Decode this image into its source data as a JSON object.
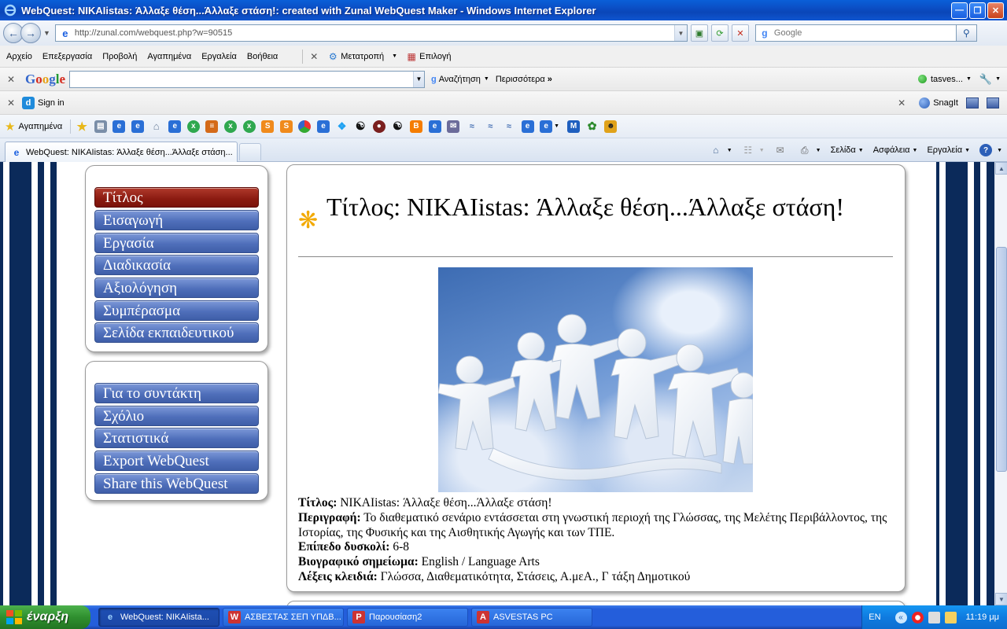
{
  "window": {
    "title": "WebQuest: NIKAIistas: Άλλαξε θέση...Άλλαξε στάση!: created with Zunal WebQuest Maker - Windows Internet Explorer"
  },
  "address_bar": {
    "url": "http://zunal.com/webquest.php?w=90515",
    "search_placeholder": "Google"
  },
  "menu_bar": {
    "items": [
      "Αρχείο",
      "Επεξεργασία",
      "Προβολή",
      "Αγαπημένα",
      "Εργαλεία",
      "Βοήθεια"
    ],
    "translate_label": "Μετατροπή",
    "select_label": "Επιλογή"
  },
  "google_toolbar": {
    "logo": "Google",
    "search_label": "Αναζήτηση",
    "more_label": "Περισσότερα",
    "user_label": "tasves..."
  },
  "sign_bar": {
    "sign_in_label": "Sign in",
    "snagit_label": "SnagIt"
  },
  "favorites_bar": {
    "label": "Αγαπημένα"
  },
  "tab_bar": {
    "active_tab_title": "WebQuest: NIKAIistas: Άλλαξε θέση...Άλλαξε στάση...",
    "page_label": "Σελίδα",
    "safety_label": "Ασφάλεια",
    "tools_label": "Εργαλεία"
  },
  "page": {
    "nav_primary": [
      {
        "label": "Τίτλος",
        "active": true
      },
      {
        "label": "Εισαγωγή",
        "active": false
      },
      {
        "label": "Εργασία",
        "active": false
      },
      {
        "label": "Διαδικασία",
        "active": false
      },
      {
        "label": "Αξιολόγηση",
        "active": false
      },
      {
        "label": "Συμπέρασμα",
        "active": false
      },
      {
        "label": "Σελίδα εκπαιδευτικού",
        "active": false
      }
    ],
    "nav_secondary": [
      {
        "label": "Για το συντάκτη"
      },
      {
        "label": "Σχόλιο"
      },
      {
        "label": "Στατιστικά"
      },
      {
        "label": "Export WebQuest"
      },
      {
        "label": "Share this WebQuest"
      }
    ],
    "heading": "Τίτλος: NIKAIistas: Άλλαξε θέση...Άλλαξε στάση!",
    "meta": {
      "title_label": "Τίτλος:",
      "title_value": "NIKAIistas: Άλλαξε θέση...Άλλαξε στάση!",
      "description_label": "Περιγραφή:",
      "description_value": "Το διαθεματικό σενάριο εντάσσεται στη γνωστική περιοχή της Γλώσσας, της Μελέτης Περιβάλλοντος, της Ιστορίας, της Φυσικής και της Αισθητικής Αγωγής και των ΤΠΕ.",
      "difficulty_label": "Επίπεδο δυσκολί:",
      "difficulty_value": "6-8",
      "bio_label": "Βιογραφικό σημείωμα:",
      "bio_value": "English / Language Arts",
      "keywords_label": "Λέξεις κλειδιά:",
      "keywords_value": "Γλώσσα, Διαθεματικότητα, Στάσεις, Α.μεΑ., Γ τάξη Δημοτικού"
    }
  },
  "taskbar": {
    "start_label": "έναρξη",
    "buttons": [
      {
        "label": "WebQuest: NIKAIista...",
        "active": true
      },
      {
        "label": "ΑΣΒΕΣΤΑΣ ΣΕΠ ΥΠΔΒ...",
        "active": false
      },
      {
        "label": "Παρουσίαση2",
        "active": false
      },
      {
        "label": "ASVESTAS PC",
        "active": false
      }
    ],
    "language": "EN",
    "clock": "11:19 μμ"
  },
  "colors": {
    "menu_button": "#4f6fba",
    "menu_button_active": "#8a1a10",
    "side_pattern": "#0b2a5a",
    "accent_flower": "#f2a900"
  }
}
